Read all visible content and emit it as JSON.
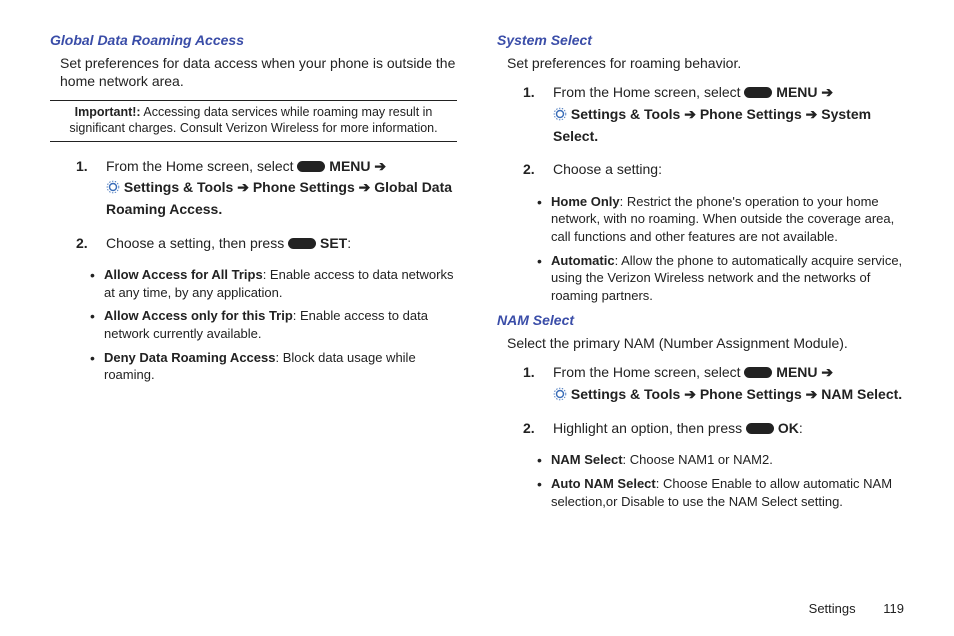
{
  "left": {
    "heading": "Global Data Roaming Access",
    "intro": "Set preferences for data access when your phone is outside the home network area.",
    "important_label": "Important!:",
    "important_text": "Accessing data services while roaming may result in significant charges. Consult Verizon Wireless for more information.",
    "step1_a": "From the Home screen, select ",
    "step1_menu": "MENU",
    "step1_b": " Settings & Tools ",
    "step1_c": " Phone Settings ",
    "step1_d": " Global Data Roaming Access",
    "step2_a": "Choose a setting, then press ",
    "step2_set": "SET",
    "opt1_name": "Allow Access for All Trips",
    "opt1_desc": ": Enable access to data networks at any time, by any application.",
    "opt2_name": "Allow Access only for this Trip",
    "opt2_desc": ": Enable access to data network currently available.",
    "opt3_name": "Deny Data Roaming Access",
    "opt3_desc": ": Block data usage while roaming."
  },
  "right1": {
    "heading": "System Select",
    "intro": "Set preferences for roaming behavior.",
    "step1_a": "From the Home screen, select ",
    "step1_menu": "MENU",
    "step1_b": " Settings & Tools ",
    "step1_c": " Phone Settings ",
    "step1_d": " System Select",
    "step2": "Choose a setting:",
    "opt1_name": "Home Only",
    "opt1_desc": ": Restrict the phone's operation to your home network, with no roaming. When outside the coverage area, call functions and other features are not available.",
    "opt2_name": "Automatic",
    "opt2_desc": ": Allow the phone to automatically acquire service, using the Verizon Wireless network and the networks of roaming partners."
  },
  "right2": {
    "heading": "NAM Select",
    "intro": "Select the primary NAM (Number Assignment Module).",
    "step1_a": "From the Home screen, select ",
    "step1_menu": "MENU",
    "step1_b": " Settings & Tools ",
    "step1_c": " Phone Settings ",
    "step1_d": " NAM Select",
    "step2_a": "Highlight an option, then press ",
    "step2_ok": "OK",
    "opt1_name": "NAM Select",
    "opt1_desc": ": Choose NAM1 or NAM2.",
    "opt2_name": "Auto NAM Select",
    "opt2_desc": ": Choose Enable to allow automatic NAM selection,or Disable to use the NAM Select setting."
  },
  "arrow": "➔",
  "footer": {
    "label": "Settings",
    "page": "119"
  }
}
